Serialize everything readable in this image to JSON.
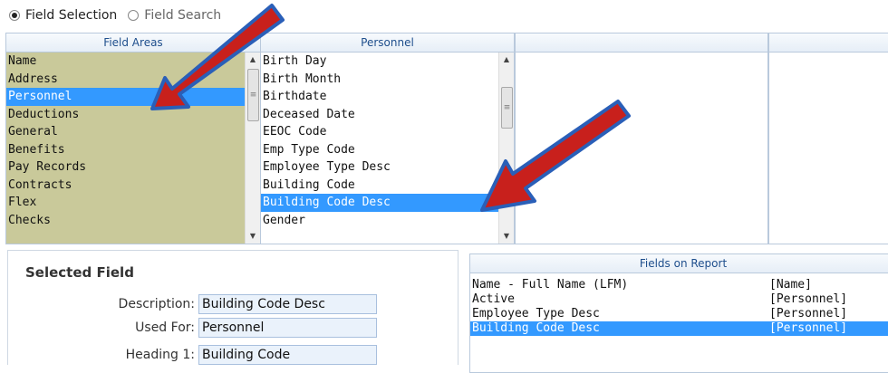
{
  "mode": {
    "option1": "Field Selection",
    "option2": "Field Search",
    "selected": "option1"
  },
  "field_areas": {
    "header": "Field Areas",
    "items": [
      "Name",
      "Address",
      "Personnel",
      "Deductions",
      "General",
      "Benefits",
      "Pay Records",
      "Contracts",
      "Flex",
      "Checks"
    ],
    "selected_index": 2
  },
  "personnel": {
    "header": "Personnel",
    "items": [
      "Birth Day",
      "Birth Month",
      "Birthdate",
      "Deceased Date",
      "EEOC Code",
      "Emp Type Code",
      "Employee Type Desc",
      "Building Code",
      "Building Code Desc",
      "Gender"
    ],
    "selected_index": 8
  },
  "selected_field": {
    "title": "Selected Field",
    "description_label": "Description:",
    "description_value": "Building Code Desc",
    "used_for_label": "Used For:",
    "used_for_value": "Personnel",
    "heading1_label": "Heading 1:",
    "heading1_value": "Building Code"
  },
  "fields_on_report": {
    "header": "Fields on Report",
    "rows": [
      {
        "name": "Name - Full Name (LFM)",
        "area": "[Name]"
      },
      {
        "name": "Active",
        "area": "[Personnel]"
      },
      {
        "name": "Employee Type Desc",
        "area": "[Personnel]"
      },
      {
        "name": "Building Code Desc",
        "area": "[Personnel]"
      }
    ],
    "selected_index": 3
  },
  "colors": {
    "selection": "#3399ff",
    "field_areas_bg": "#c9c99a",
    "header_text": "#1e4e8c",
    "arrow_fill": "#c8201c",
    "arrow_outline": "#2a5fb8"
  }
}
